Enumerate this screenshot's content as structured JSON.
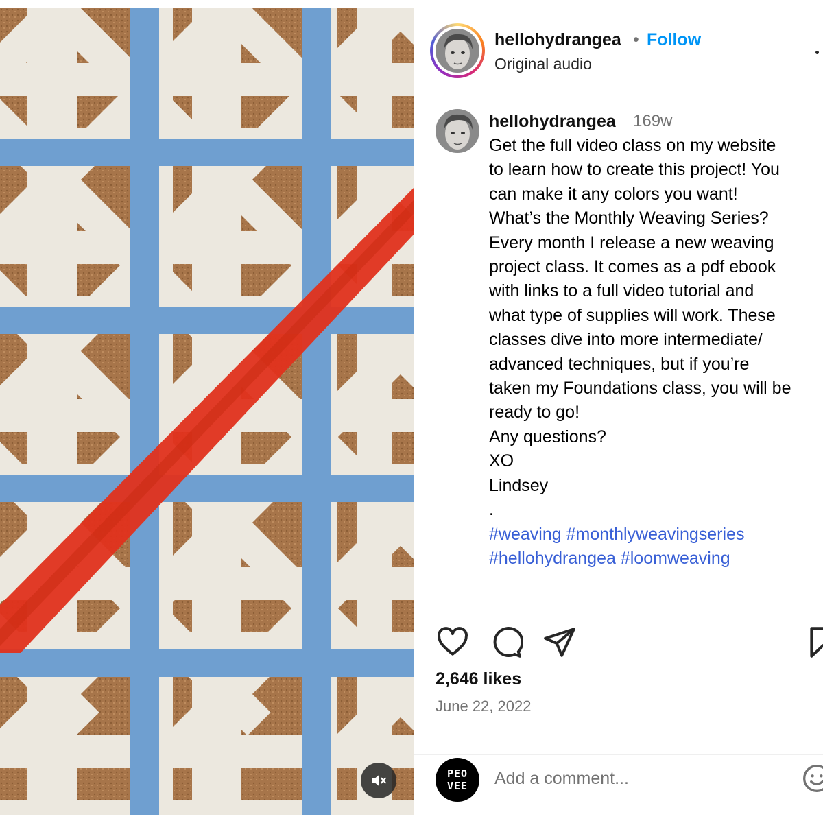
{
  "post": {
    "username": "hellohydrangea",
    "separator": "•",
    "follow_label": "Follow",
    "audio_label": "Original audio",
    "more_icon": "more-horizontal-icon"
  },
  "caption": {
    "username": "hellohydrangea",
    "time_ago": "169w",
    "lines": [
      "Get the full video class on my website",
      "to learn how to create this project! You",
      "can make it any colors you want!",
      "What’s the Monthly Weaving Series?",
      "Every month I release a new weaving",
      "project class. It comes as a pdf ebook",
      "with links to a full video tutorial and",
      "what type of supplies will work. These",
      "classes dive into more intermediate/",
      "advanced techniques, but if you’re",
      "taken my Foundations class, you will be",
      "ready to go!",
      "Any questions?",
      "XO",
      "Lindsey",
      "."
    ],
    "hashtags_line1": [
      "#weaving",
      "#monthlyweavingseries"
    ],
    "hashtags_line2": [
      "#hellohydrangea",
      "#loomweaving"
    ]
  },
  "actions": {
    "like_icon": "heart-icon",
    "comment_icon": "comment-icon",
    "share_icon": "send-icon",
    "save_icon": "bookmark-icon",
    "likes_text": "2,646 likes",
    "date_text": "June 22, 2022"
  },
  "comment": {
    "avatar_line1": "PEO",
    "avatar_line2": "VEE",
    "placeholder": "Add a comment...",
    "emoji_icon": "smiley-icon"
  },
  "media": {
    "mute_icon": "speaker-muted-icon"
  },
  "colors": {
    "follow_blue": "#0095f6",
    "hashtag_blue": "#385fd6",
    "weave_blue": "#6f9fd0",
    "weave_red": "#e0321c",
    "weave_cream": "#ece8df",
    "cork": "#a7754a"
  }
}
